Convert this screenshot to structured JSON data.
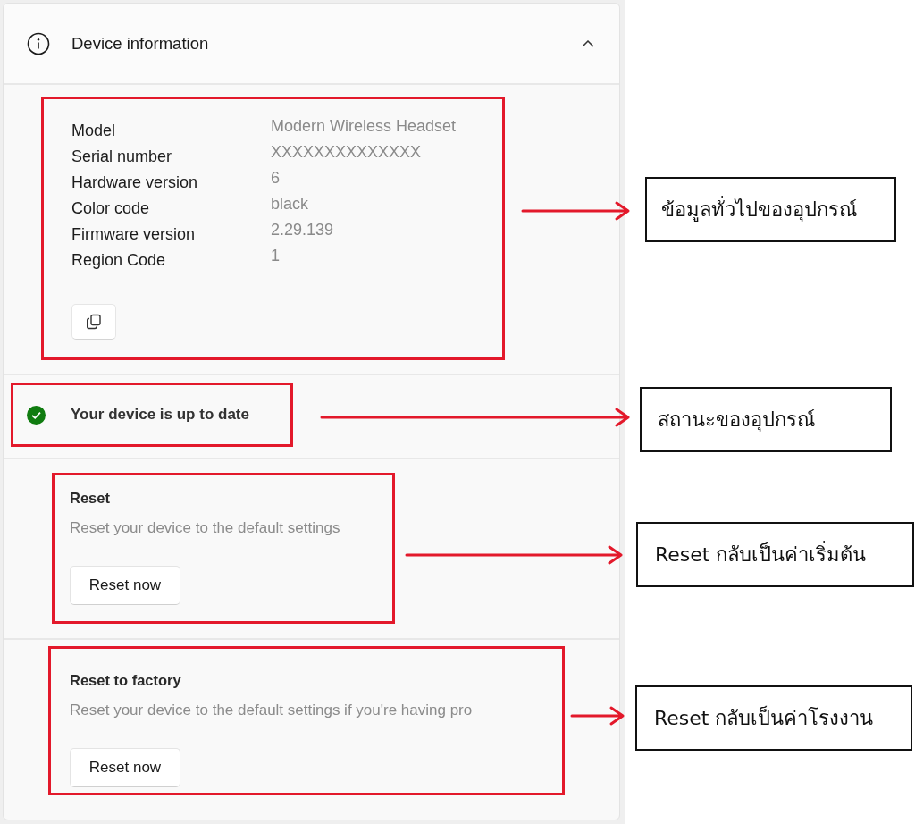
{
  "panel": {
    "header": {
      "title": "Device information",
      "expanded": true
    },
    "device_info": {
      "rows": [
        {
          "label": "Model",
          "value": "Modern Wireless Headset"
        },
        {
          "label": "Serial number",
          "value": "XXXXXXXXXXXXXX"
        },
        {
          "label": "Hardware version",
          "value": "6"
        },
        {
          "label": "Color code",
          "value": "black"
        },
        {
          "label": "Firmware version",
          "value": "2.29.139"
        },
        {
          "label": "Region Code",
          "value": "1"
        }
      ]
    },
    "status": {
      "text": "Your device is up to date"
    },
    "actions": [
      {
        "title": "Reset",
        "description": "Reset your device to the default settings",
        "button": "Reset now"
      },
      {
        "title": "Reset to factory",
        "description": "Reset your device to the default settings if you're having pro",
        "button": "Reset now"
      }
    ]
  },
  "annotations": [
    {
      "text": "ข้อมูลทั่วไปของอุปกรณ์"
    },
    {
      "text": "สถานะของอุปกรณ์"
    },
    {
      "text": "Reset กลับเป็นค่าเริ่มต้น"
    },
    {
      "text": "Reset กลับเป็นค่าโรงงาน"
    }
  ]
}
